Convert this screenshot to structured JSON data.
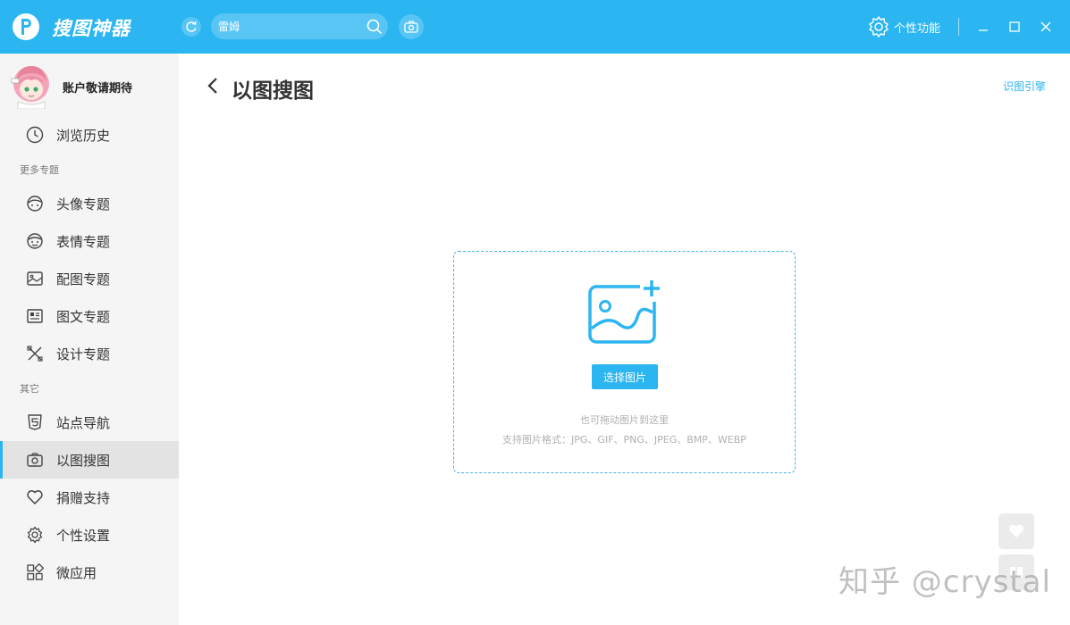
{
  "app": {
    "name": "搜图神器",
    "brand_color": "#2bb5f1"
  },
  "search": {
    "value": "雷姆",
    "placeholder": ""
  },
  "titlebar": {
    "personal_label": "个性功能"
  },
  "user": {
    "name": "账户敬请期待"
  },
  "sidebar": {
    "history": {
      "label": "浏览历史",
      "icon": "clock-icon"
    },
    "section_topics": "更多专题",
    "topics": [
      {
        "label": "头像专题",
        "icon": "face-icon"
      },
      {
        "label": "表情专题",
        "icon": "emoji-icon"
      },
      {
        "label": "配图专题",
        "icon": "image-icon"
      },
      {
        "label": "图文专题",
        "icon": "article-icon"
      },
      {
        "label": "设计专题",
        "icon": "design-tools-icon"
      }
    ],
    "section_other": "其它",
    "other": [
      {
        "label": "站点导航",
        "icon": "html5-icon"
      },
      {
        "label": "以图搜图",
        "icon": "camera-icon",
        "active": true
      },
      {
        "label": "捐赠支持",
        "icon": "heart-icon"
      },
      {
        "label": "个性设置",
        "icon": "gear-icon"
      },
      {
        "label": "微应用",
        "icon": "apps-grid-icon"
      }
    ]
  },
  "main": {
    "title": "以图搜图",
    "engine_link": "识图引擎",
    "upload": {
      "button_label": "选择图片",
      "hint_drag": "也可拖动图片到这里",
      "hint_formats": "支持图片格式：JPG、GIF、PNG、JPEG、BMP、WEBP"
    }
  },
  "watermark": "知乎 @crystal"
}
